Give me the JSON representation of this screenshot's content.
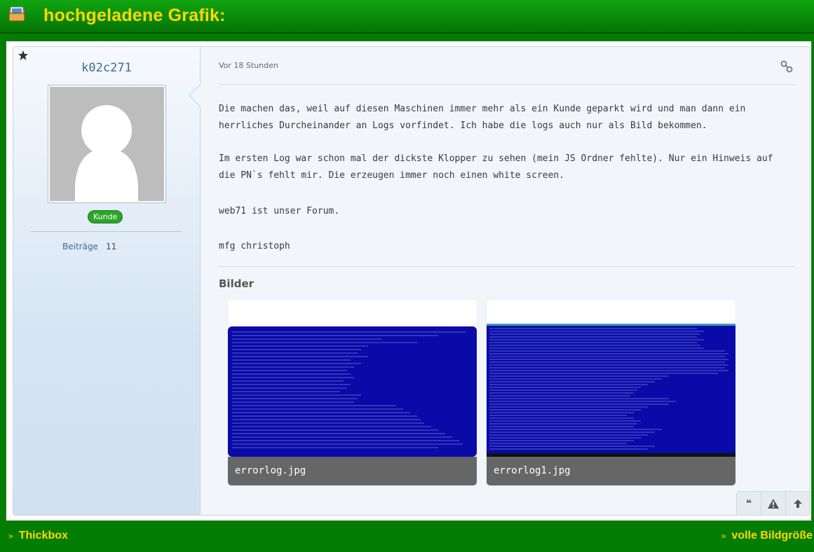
{
  "header": {
    "icon": "folder-image-icon",
    "title": "hochgeladene Grafik:"
  },
  "post": {
    "author": {
      "username": "k02c271",
      "badge": "Kunde",
      "stats": [
        {
          "label": "Beiträge",
          "value": "11"
        }
      ],
      "icons": {
        "star": "star-icon",
        "avatar": "default-avatar-silhouette"
      }
    },
    "time": "Vor 18 Stunden",
    "link_icon": "permalink-icon",
    "body": [
      "Die machen das, weil auf diesen Maschinen immer mehr als ein Kunde geparkt wird und man dann ein herrliches Durcheinander an Logs vorfindet. Ich habe die logs auch nur als Bild bekommen.",
      "Im ersten Log war schon mal der dickste Klopper zu sehen (mein JS Ordner fehlte). Nur ein Hinweis auf die PN`s fehlt mir. Die erzeugen immer noch einen white screen.",
      "web71 ist unser Forum.",
      "mfg christoph"
    ],
    "images_title": "Bilder",
    "images": [
      {
        "caption": "errorlog.jpg"
      },
      {
        "caption": "errorlog1.jpg"
      }
    ],
    "actions": [
      {
        "glyph": "❝",
        "icon": "quote-icon"
      },
      {
        "glyph": "▲",
        "icon": "warning-icon"
      },
      {
        "glyph": "🡑",
        "icon": "arrow-up-icon"
      }
    ]
  },
  "footer": {
    "left_link": "Thickbox",
    "right_link": "volle Bildgröße",
    "prefix": "»"
  },
  "colors": {
    "background": "#047d04",
    "title": "#ffd800",
    "screenshot_blue": "#0a0aa8",
    "caption_bg": "#666666",
    "badge": "#2aa52a"
  }
}
